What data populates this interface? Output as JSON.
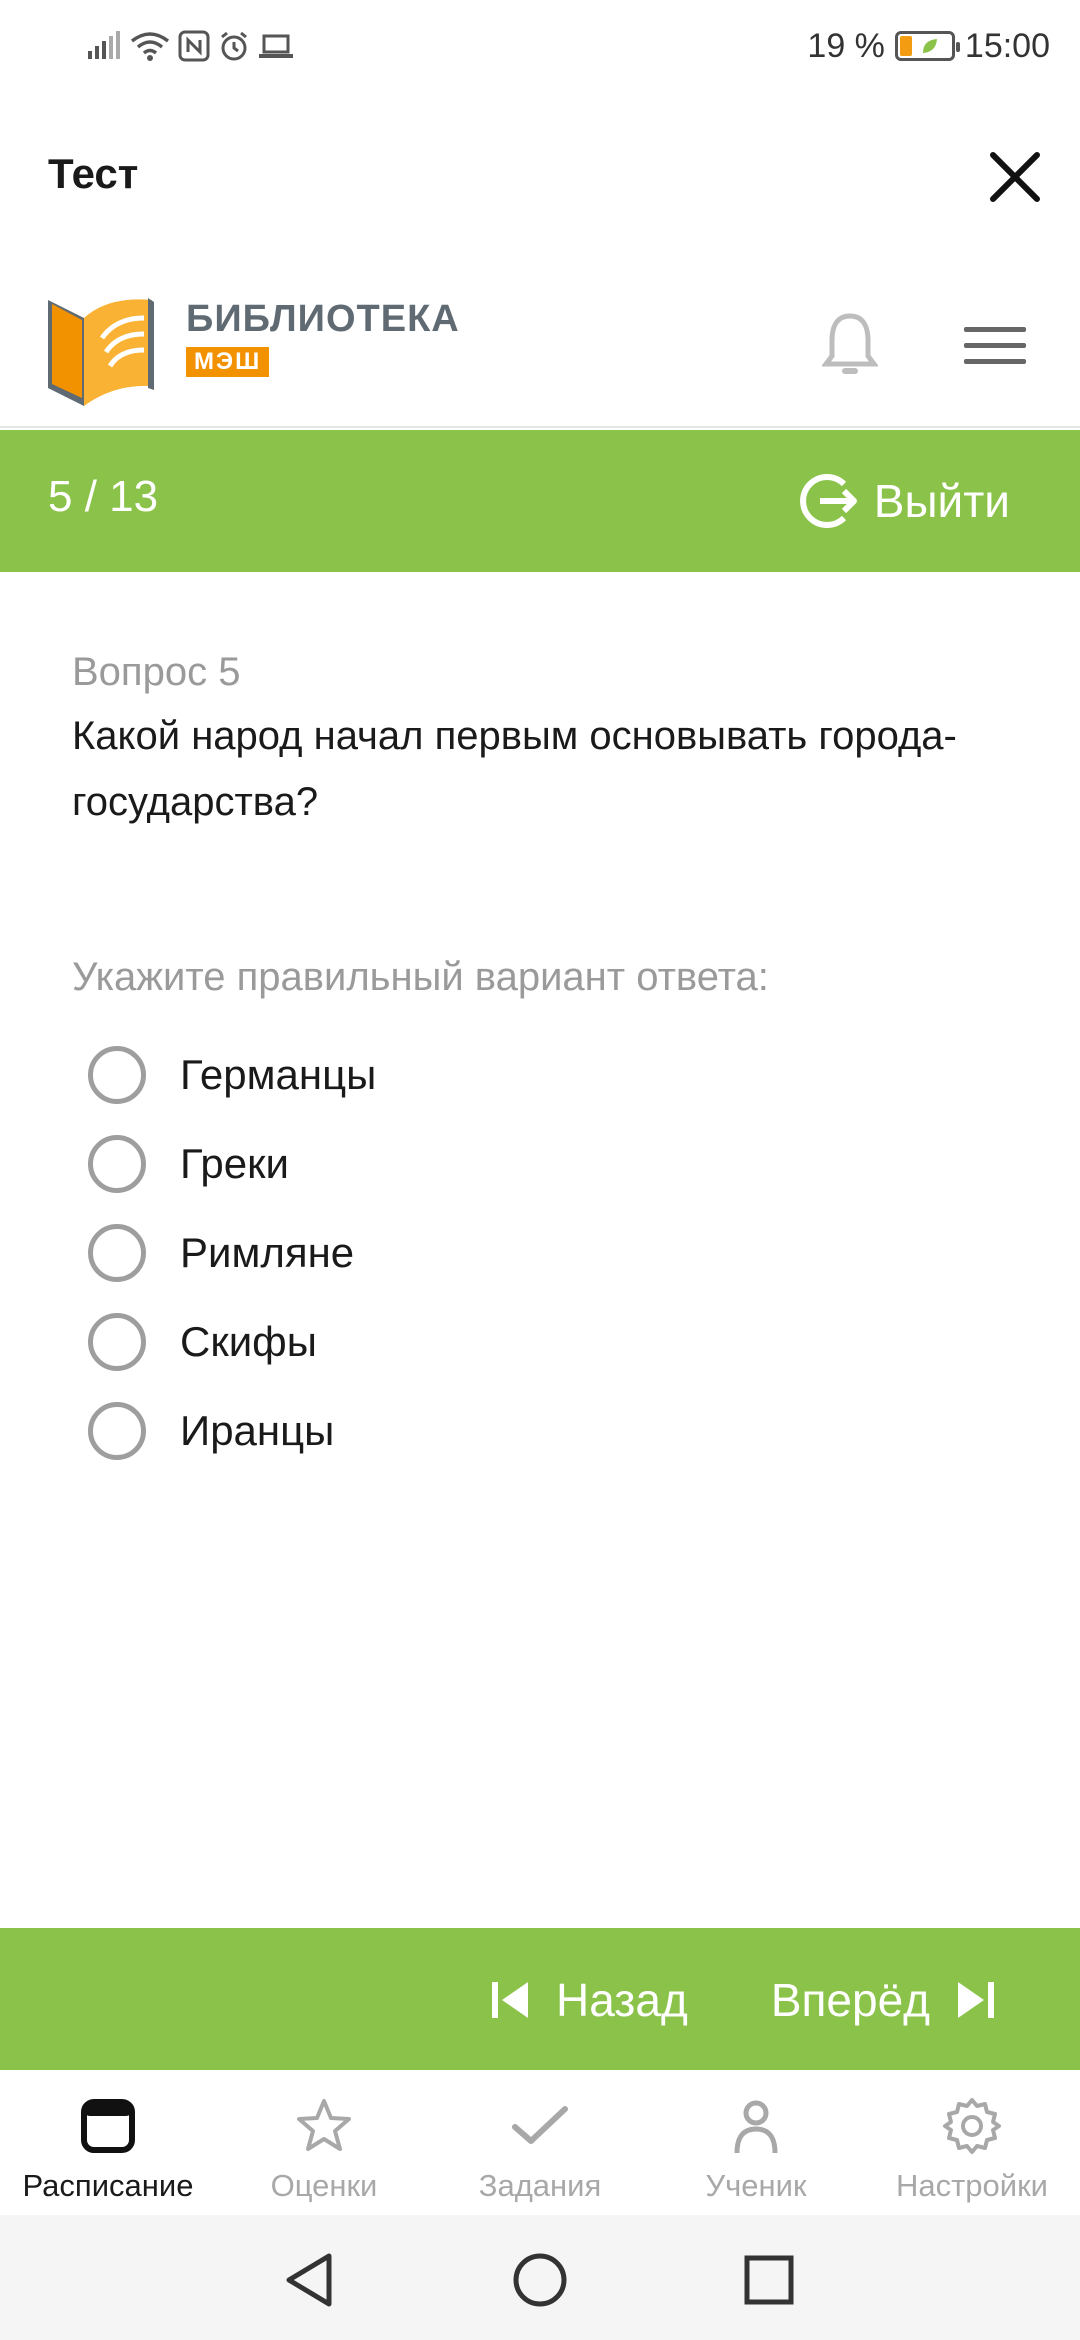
{
  "status_bar": {
    "battery_percent": "19 %",
    "time": "15:00",
    "icons": [
      "signal-icon",
      "wifi-icon",
      "nfc-icon",
      "alarm-icon",
      "laptop-icon"
    ]
  },
  "app_bar": {
    "title": "Тест",
    "close_icon": "close-icon"
  },
  "header": {
    "logo_title": "БИБЛИОТЕКА",
    "logo_subtitle": "МЭШ",
    "icons": [
      "bell-icon",
      "menu-icon"
    ]
  },
  "progress": {
    "label": "5 / 13",
    "exit_label": "Выйти"
  },
  "question": {
    "number_label": "Вопрос 5",
    "text": "Какой народ начал первым основывать города-государства?",
    "hint": "Укажите правильный вариант ответа:",
    "options": [
      {
        "label": "Германцы",
        "selected": false
      },
      {
        "label": "Греки",
        "selected": false
      },
      {
        "label": "Римляне",
        "selected": false
      },
      {
        "label": "Скифы",
        "selected": false
      },
      {
        "label": "Иранцы",
        "selected": false
      }
    ]
  },
  "navigation": {
    "back_label": "Назад",
    "next_label": "Вперёд"
  },
  "tabs": [
    {
      "label": "Расписание",
      "icon": "calendar-icon",
      "active": true
    },
    {
      "label": "Оценки",
      "icon": "star-icon",
      "active": false
    },
    {
      "label": "Задания",
      "icon": "check-icon",
      "active": false
    },
    {
      "label": "Ученик",
      "icon": "person-icon",
      "active": false
    },
    {
      "label": "Настройки",
      "icon": "gear-icon",
      "active": false
    }
  ],
  "colors": {
    "accent_green": "#8bc34a",
    "logo_orange": "#f39200",
    "logo_gray": "#5f6a72",
    "muted_text": "#9a9a9a"
  }
}
